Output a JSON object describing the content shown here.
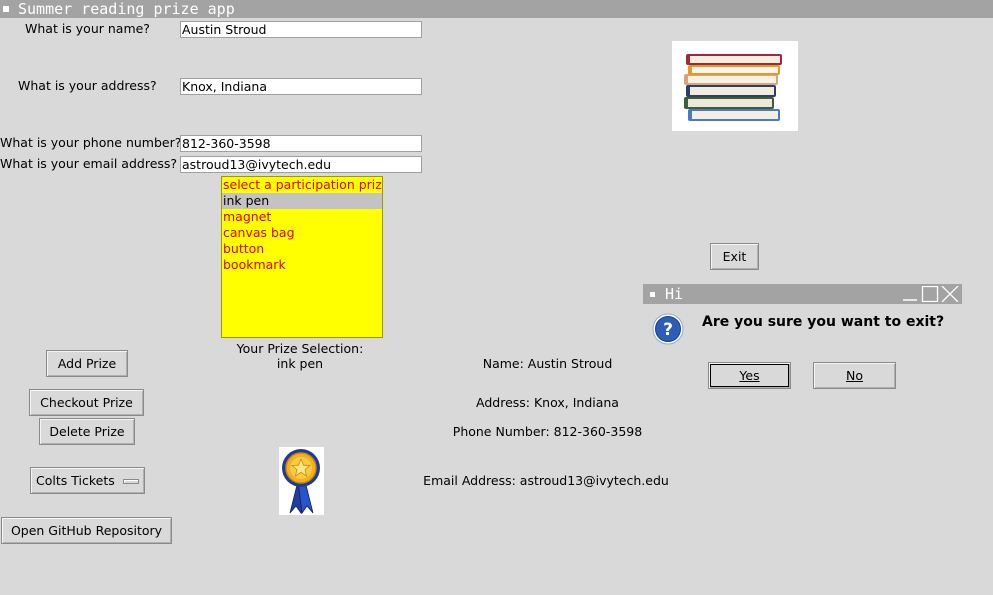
{
  "window": {
    "title": "Summer reading prize app"
  },
  "form": {
    "name_label": "What is your name?",
    "name_value": "Austin Stroud",
    "address_label": "What is your address?",
    "address_value": "Knox, Indiana",
    "phone_label": "What is your phone number?",
    "phone_value": "812-360-3598",
    "email_label": "What is your email address?",
    "email_value": "astroud13@ivytech.edu"
  },
  "prize_list": {
    "items": [
      "select a participation prize",
      "ink pen",
      "magnet",
      "canvas bag",
      "button",
      "bookmark"
    ],
    "selected": "ink pen"
  },
  "selection": {
    "heading": "Your Prize Selection:",
    "value": "ink pen"
  },
  "buttons": {
    "add_prize": "Add Prize",
    "checkout_prize": "Checkout Prize",
    "delete_prize": "Delete Prize",
    "colts_tickets": "Colts Tickets",
    "open_github": "Open GitHub Repository",
    "exit": "Exit"
  },
  "summary": {
    "name": "Name: Austin Stroud",
    "address": "Address: Knox, Indiana",
    "phone": "Phone Number: 812-360-3598",
    "email": "Email Address: astroud13@ivytech.edu"
  },
  "dialog": {
    "title": "Hi",
    "message": "Are you sure you want to exit?",
    "yes": "Yes",
    "no": "No"
  },
  "colors": {
    "listbox_bg": "#ffff00",
    "listbox_text": "#e00000",
    "titlebar_bg": "#a3a3a3",
    "window_bg": "#d9d9d9"
  },
  "icons": [
    "books-image",
    "award-ribbon-icon",
    "question-icon",
    "minimize-icon",
    "maximize-icon",
    "close-icon"
  ]
}
